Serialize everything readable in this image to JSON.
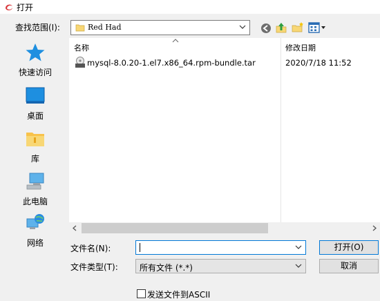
{
  "window": {
    "title": "打开"
  },
  "lookin": {
    "label": "查找范围(I):",
    "value": "Red Had"
  },
  "places": [
    {
      "label": "快速访问",
      "icon": "star-icon"
    },
    {
      "label": "桌面",
      "icon": "desktop-icon"
    },
    {
      "label": "库",
      "icon": "library-folder-icon"
    },
    {
      "label": "此电脑",
      "icon": "computer-icon"
    },
    {
      "label": "网络",
      "icon": "network-icon"
    }
  ],
  "filelist": {
    "columns": {
      "name": "名称",
      "date": "修改日期"
    },
    "rows": [
      {
        "name": "mysql-8.0.20-1.el7.x86_64.rpm-bundle.tar",
        "date": "2020/7/18 11:52",
        "icon": "tar-archive-icon"
      }
    ]
  },
  "filename": {
    "label": "文件名(N):",
    "value": ""
  },
  "filetype": {
    "label": "文件类型(T):",
    "value": "所有文件 (*.*)"
  },
  "buttons": {
    "open": "打开(O)",
    "cancel": "取消"
  },
  "ascii": {
    "label": "发送文件到ASCII",
    "checked": false
  },
  "colors": {
    "accent": "#0078d7",
    "folder": "#f8d775"
  }
}
